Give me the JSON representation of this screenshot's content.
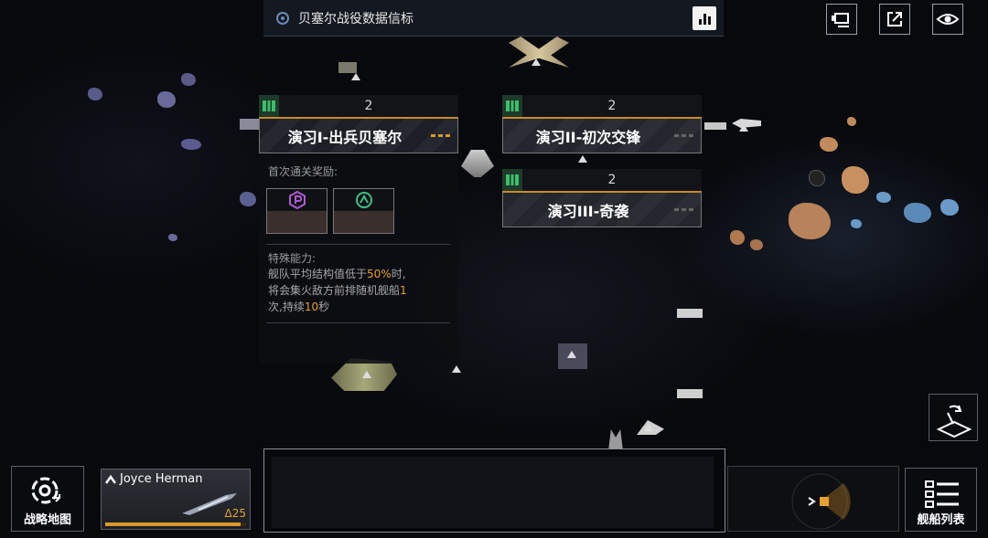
{
  "banner": {
    "title": "贝塞尔战役数据信标",
    "icon": "beacon-icon"
  },
  "top_right_buttons": [
    {
      "icon": "camera-icon"
    },
    {
      "icon": "external-link-icon"
    },
    {
      "icon": "eye-icon"
    }
  ],
  "missions": [
    {
      "count": "2",
      "label": "演习I-出兵贝塞尔",
      "state": "selected"
    },
    {
      "count": "2",
      "label": "演习II-初次交锋",
      "state": "normal"
    },
    {
      "count": "2",
      "label": "演习III-奇袭",
      "state": "normal"
    }
  ],
  "details": {
    "first_clear_reward_title": "首次通关奖励:",
    "rewards": [
      {
        "icon": "purple-p-badge-icon",
        "color": "#b05ad8"
      },
      {
        "icon": "green-chevron-badge-icon",
        "color": "#3cbf8a"
      }
    ],
    "ability_title": "特殊能力:",
    "ability_text": {
      "p1": "舰队平均结构值低于",
      "v1": "50%",
      "p2": "时,",
      "p3": "将会集火敌方前排随机舰船",
      "v2": "1",
      "p4": "次,持续",
      "v3": "10",
      "p5": "秒"
    }
  },
  "bottom": {
    "strategy_map_label": "战略地图",
    "fleet_name": "Joyce Herman",
    "fleet_level": "25",
    "fleet_list_label": "舰船列表"
  },
  "colors": {
    "accent": "#d89a2a",
    "green": "#3cbf6a"
  }
}
